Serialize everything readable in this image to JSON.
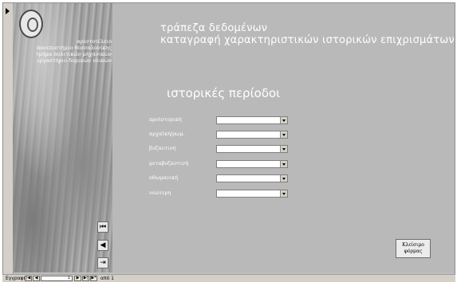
{
  "sidebar": {
    "university_text": [
      "αριστοτέλειο",
      "πανεπιστήμιο θεσσαλονίκης",
      "τμήμα πολιτικών μηχανικών",
      "εργαστήριο δομικών υλικών"
    ],
    "nav": [
      {
        "glyph": "⏮"
      },
      {
        "glyph": "◀"
      },
      {
        "glyph": "⇥"
      }
    ]
  },
  "main": {
    "title_line1": "τράπεζα δεδομένων",
    "title_line2": "καταγραφή χαρακτηριστικών ιστορικών επιχρισμάτων",
    "heading": "ιστορικές περίοδοι",
    "periods": [
      {
        "label": "προϊστορική",
        "value": ""
      },
      {
        "label": "αρχαϊκή/ρωμ.",
        "value": ""
      },
      {
        "label": "βυζαντινή",
        "value": ""
      },
      {
        "label": "μεταβυζαντινή",
        "value": ""
      },
      {
        "label": "οθωμανική",
        "value": ""
      },
      {
        "label": "νεώτερη",
        "value": ""
      }
    ],
    "close_button": [
      "Κλείσιμο",
      "φόρμας"
    ]
  },
  "statusbar": {
    "record_label": "Εγγραφή:",
    "first_btn": "|◀",
    "prev_btn": "◀",
    "current_record": "1",
    "next_btn": "▶",
    "last_btn": "▶|",
    "new_btn": "▶*",
    "total": "από 1"
  }
}
